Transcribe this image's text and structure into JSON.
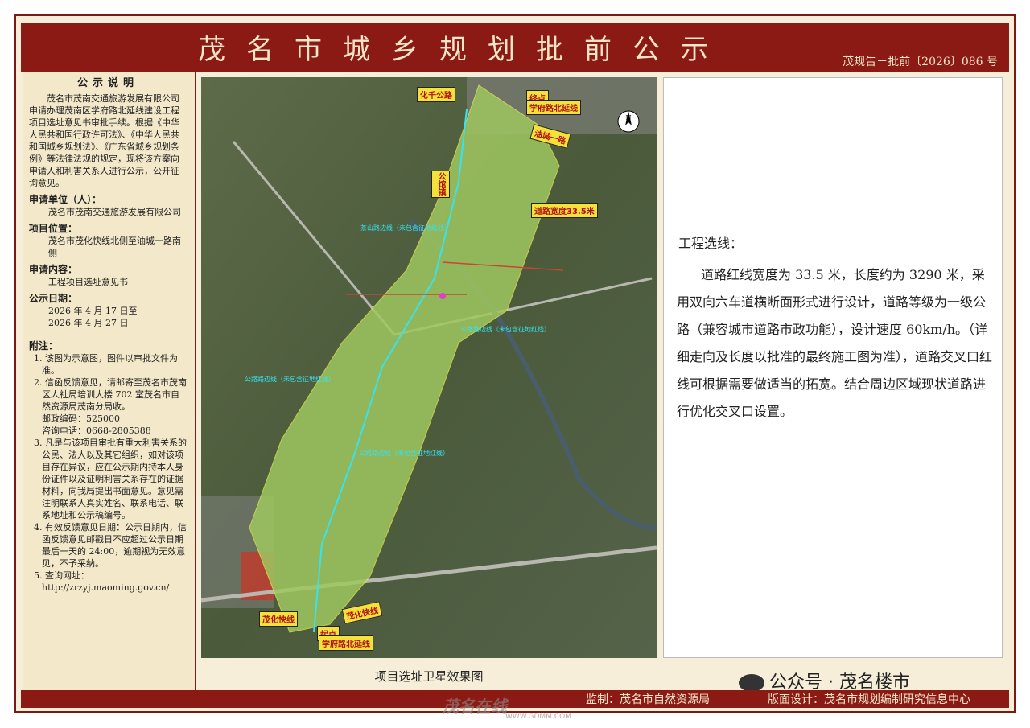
{
  "header": {
    "title": "茂名市城乡规划批前公示",
    "doc_number": "茂规告－批前〔2026〕086 号"
  },
  "notice": {
    "heading": "公示说明",
    "paragraph": "茂名市茂南交通旅游发展有限公司申请办理茂南区学府路北延线建设工程项目选址意见书审批手续。根据《中华人民共和国行政许可法》、《中华人民共和国城乡规划法》、《广东省城乡规划条例》等法律法规的规定，现将该方案向申请人和利害关系人进行公示，公开征询意见。",
    "applicant_label": "申请单位（人）：",
    "applicant": "茂名市茂南交通旅游发展有限公司",
    "location_label": "项目位置：",
    "location": "茂名市茂化快线北侧至油城一路南侧",
    "content_label": "申请内容：",
    "content": "工程项目选址意见书",
    "date_label": "公示日期：",
    "date_start": "2026 年 4 月 17 日至",
    "date_end": "2026 年 4 月 27 日",
    "notes_label": "附注：",
    "notes": [
      "1. 该图为示意图，图件以审批文件为准。",
      "2. 信函反馈意见，请邮寄至茂名市茂南区人社局培训大楼 702 室茂名市自然资源局茂南分局收。",
      "邮政编码：525000",
      "咨询电话：0668-2805388",
      "3. 凡是与该项目审批有重大利害关系的公民、法人以及其它组织，如对该项目存在异议，应在公示期内持本人身份证件以及证明利害关系存在的证据材料，向我局提出书面意见。意见需注明联系人真实姓名、联系电话、联系地址和公示稿编号。",
      "4. 有效反馈意见日期：公示日期内，信函反馈意见邮戳日不应超过公示日期最后一天的 24:00，逾期视为无效意见，不予采纳。",
      "5. 查询网址：",
      "http://zrzyj.maoming.gov.cn/"
    ]
  },
  "map": {
    "caption": "项目选址卫星效果图",
    "labels": {
      "huaqi": "化千公路",
      "endpoint_top": "终点",
      "xuefu_top": "学府路北延线",
      "youcheng": "油城一路",
      "gongguan": "公馆镇",
      "road_width": "道路宽度33.5米",
      "maohua_left": "茂化快线",
      "maohua_right": "茂化快线",
      "start": "起点",
      "xuefu_bottom": "学府路北延线",
      "cyan1": "茶山路边线（未包含征地红线）",
      "cyan2": "公路路边线（未包含征地红线）",
      "cyan3": "公路路边线（未包含征地红线）",
      "cyan4": "公路路边线（未包含征地红线）"
    },
    "colors": {
      "route": "#37e3f0",
      "label_bg": "#f4e23a",
      "label_text": "#b01010"
    }
  },
  "description": {
    "heading": "工程选线：",
    "body": "道路红线宽度为 33.5 米，长度约为 3290 米，采用双向六车道横断面形式进行设计，道路等级为一级公路（兼容城市道路市政功能），设计速度 60km/h。（详细走向及长度以批准的最终施工图为准），道路交叉口红线可根据需要做适当的拓宽。结合周边区域现状道路进行优化交叉口设置。"
  },
  "footer": {
    "supervise": "监制：茂名市自然资源局",
    "design": "版面设计：茂名市规划编制研究信息中心"
  },
  "watermarks": {
    "wechat": "公众号 · 茂名楼市",
    "site_logo": "茂名在线",
    "site_url": "WWW.GDMM.COM"
  }
}
